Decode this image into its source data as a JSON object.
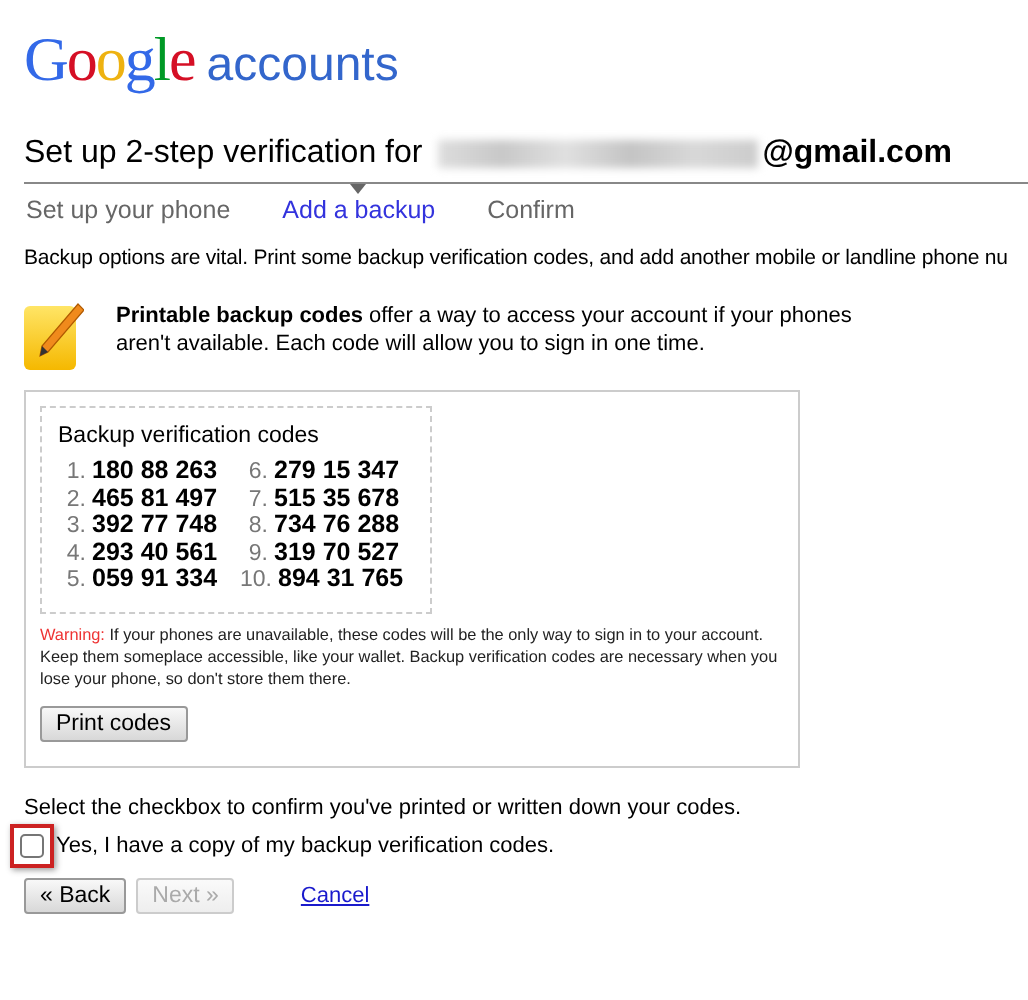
{
  "logo": {
    "brand": "Google",
    "product": "accounts"
  },
  "heading": {
    "prefix": "Set up 2-step verification for",
    "email_domain": "@gmail.com"
  },
  "steps": [
    {
      "label": "Set up your phone",
      "selected": false
    },
    {
      "label": "Add a backup",
      "selected": true
    },
    {
      "label": "Confirm",
      "selected": false
    }
  ],
  "intro": "Backup options are vital. Print some backup verification codes, and add another mobile or landline phone nu",
  "info": {
    "text": "**Printable backup codes** offer a way to access your account if your phones aren't available. Each code will allow you to sign in one time."
  },
  "codes_panel": {
    "title": "Backup verification codes",
    "codes": [
      {
        "number": "1.",
        "code": "180 88 263"
      },
      {
        "number": "2.",
        "code": "465 81 497"
      },
      {
        "number": "3.",
        "code": "392 77 748"
      },
      {
        "number": "4.",
        "code": "293 40 561"
      },
      {
        "number": "5.",
        "code": "059 91 334"
      },
      {
        "number": "6.",
        "code": "279 15 347"
      },
      {
        "number": "7.",
        "code": "515 35 678"
      },
      {
        "number": "8.",
        "code": "734 76 288"
      },
      {
        "number": "9.",
        "code": "319 70 527"
      },
      {
        "number": "10.",
        "code": "894 31 765"
      }
    ],
    "warning_label": "Warning:",
    "warning": "If your phones are unavailable, these codes will be the only way to sign in to your account. Keep them someplace accessible, like your wallet. Backup verification codes are necessary when you lose your phone, so don't store them there.",
    "print_button": "Print codes"
  },
  "confirm": {
    "instruction": "Select the checkbox to confirm you've printed or written down your codes.",
    "label": "Yes, I have a copy of my backup verification codes.",
    "checked": false,
    "highlighted": true
  },
  "buttons": [
    {
      "label": "« Back",
      "kind": "button",
      "disabled": false
    },
    {
      "label": "Next »",
      "kind": "button",
      "disabled": true
    },
    {
      "label": "Cancel",
      "kind": "link"
    }
  ]
}
